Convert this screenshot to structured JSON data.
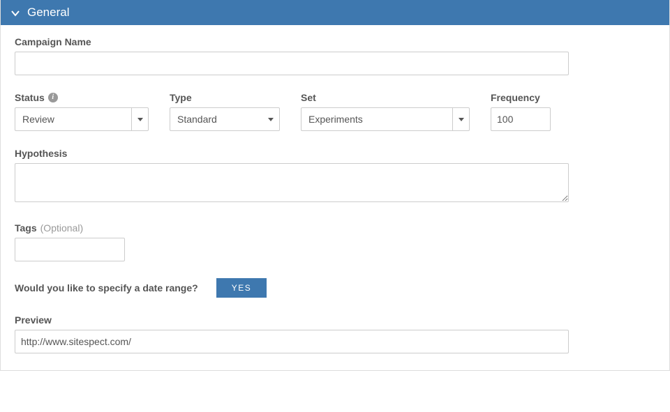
{
  "header": {
    "title": "General"
  },
  "campaign": {
    "label": "Campaign Name",
    "value": ""
  },
  "status": {
    "label": "Status",
    "value": "Review"
  },
  "type": {
    "label": "Type",
    "value": "Standard"
  },
  "set": {
    "label": "Set",
    "value": "Experiments"
  },
  "frequency": {
    "label": "Frequency",
    "value": "100"
  },
  "hypothesis": {
    "label": "Hypothesis",
    "value": ""
  },
  "tags": {
    "label": "Tags",
    "optional": "(Optional)"
  },
  "daterange": {
    "question": "Would you like to specify a date range?",
    "yes": "YES"
  },
  "preview": {
    "label": "Preview",
    "value": "http://www.sitespect.com/"
  }
}
